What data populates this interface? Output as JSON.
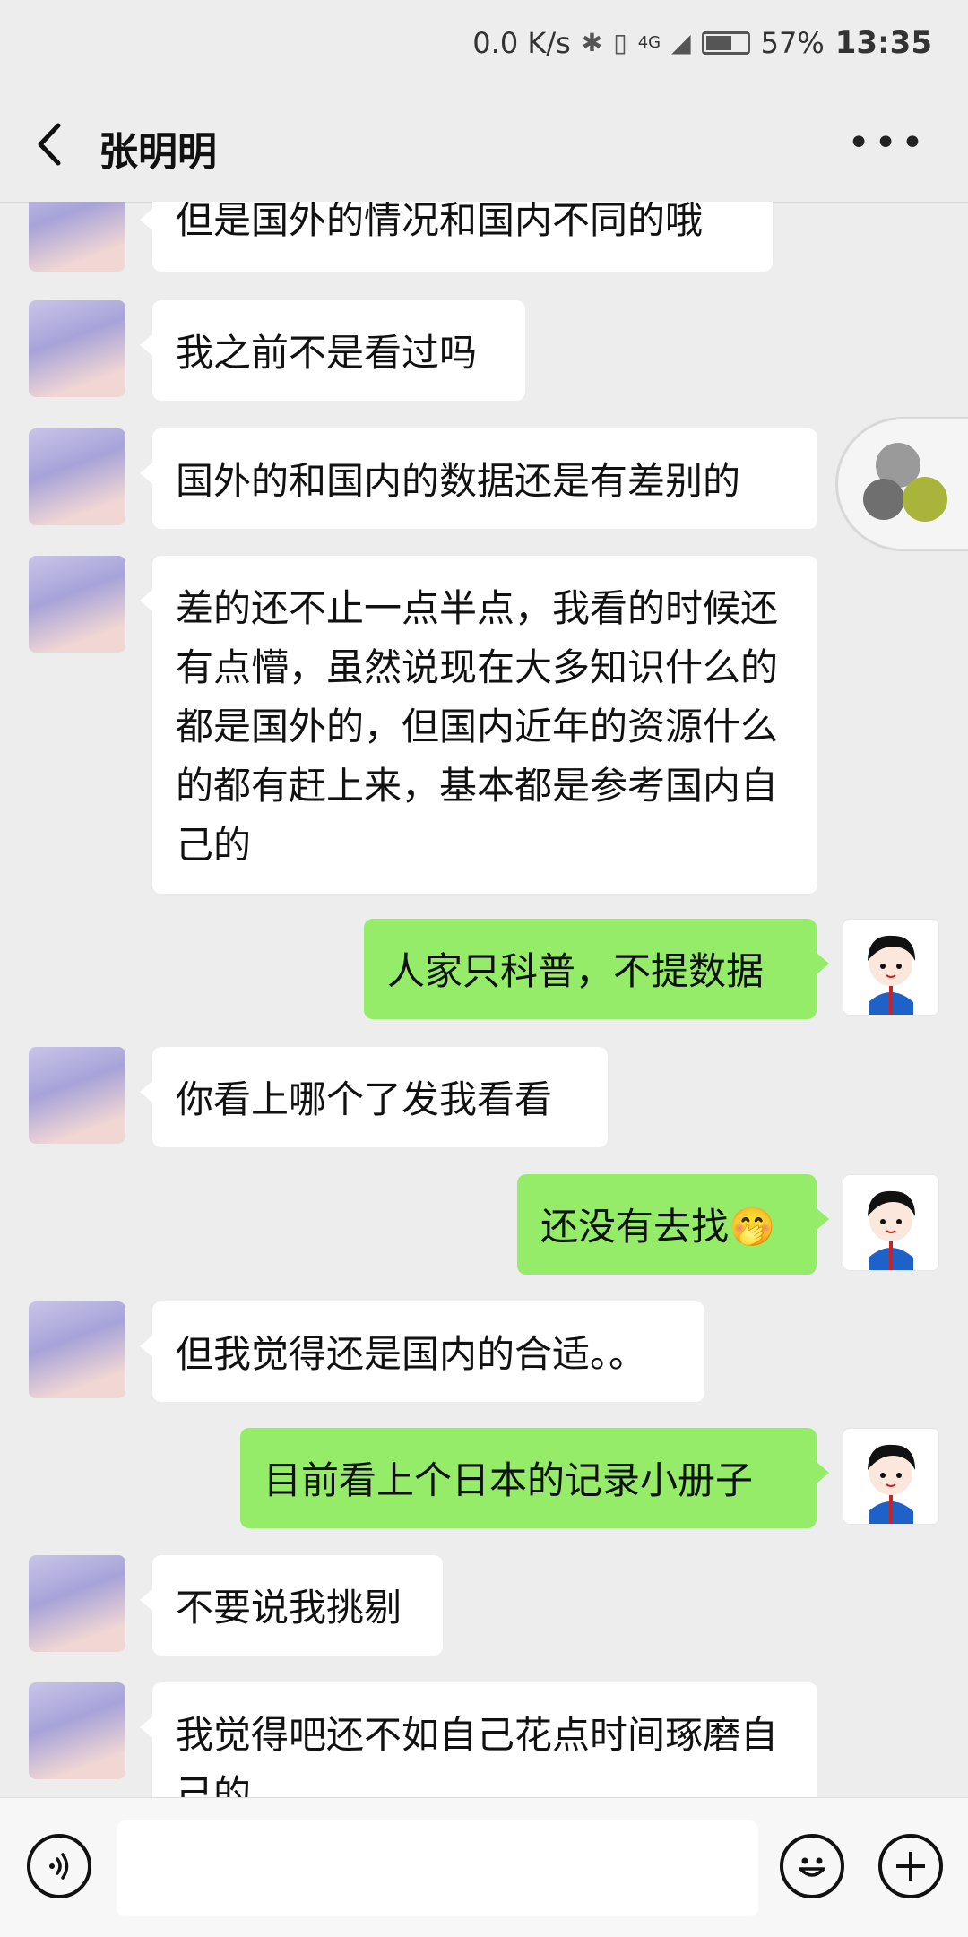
{
  "status_bar": {
    "network_speed": "0.0 K/s",
    "signal_label": "4G",
    "battery": "57%",
    "time": "13:35"
  },
  "header": {
    "title": "张明明"
  },
  "messages": [
    {
      "from": "other",
      "text": "但是国外的情况和国内不同的哦"
    },
    {
      "from": "other",
      "text": "我之前不是看过吗"
    },
    {
      "from": "other",
      "text": "国外的和国内的数据还是有差别的"
    },
    {
      "from": "other",
      "text": "差的还不止一点半点，我看的时候还有点懵，虽然说现在大多知识什么的都是国外的，但国内近年的资源什么的都有赶上来，基本都是参考国内自己的"
    },
    {
      "from": "me",
      "text": "人家只科普，不提数据"
    },
    {
      "from": "other",
      "text": "你看上哪个了发我看看"
    },
    {
      "from": "me",
      "text": "还没有去找🤭"
    },
    {
      "from": "other",
      "text": "但我觉得还是国内的合适。。"
    },
    {
      "from": "me",
      "text": "目前看上个日本的记录小册子"
    },
    {
      "from": "other",
      "text": "不要说我挑剔"
    },
    {
      "from": "other",
      "text": "我觉得吧还不如自己花点时间琢磨自己的"
    }
  ],
  "input": {
    "placeholder": ""
  },
  "colors": {
    "background": "#ededed",
    "outgoing_bubble": "#95ec69",
    "incoming_bubble": "#ffffff"
  }
}
